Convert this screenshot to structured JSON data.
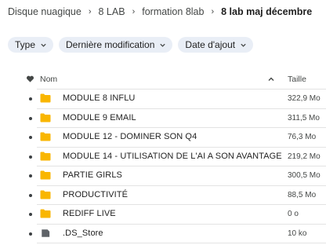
{
  "breadcrumb": {
    "items": [
      "Disque nuagique",
      "8 LAB",
      "formation 8lab"
    ],
    "current": "8 lab maj décembre"
  },
  "filters": [
    {
      "label": "Type"
    },
    {
      "label": "Dernière modification"
    },
    {
      "label": "Date d'ajout"
    }
  ],
  "columns": {
    "name": "Nom",
    "size": "Taille"
  },
  "files": [
    {
      "name": "MODULE 8 INFLU",
      "size": "322,9 Mo",
      "kind": "folder"
    },
    {
      "name": "MODULE 9 EMAIL",
      "size": "311,5 Mo",
      "kind": "folder"
    },
    {
      "name": "MODULE 12 - DOMINER SON Q4",
      "size": "76,3 Mo",
      "kind": "folder"
    },
    {
      "name": "MODULE 14 - UTILISATION DE L'AI A SON AVANTAGE",
      "size": "219,2 Mo",
      "kind": "folder"
    },
    {
      "name": "PARTIE GIRLS",
      "size": "300,5 Mo",
      "kind": "folder"
    },
    {
      "name": "PRODUCTIVITÉ",
      "size": "88,5 Mo",
      "kind": "folder"
    },
    {
      "name": "REDIFF LIVE",
      "size": "0 o",
      "kind": "folder"
    },
    {
      "name": ".DS_Store",
      "size": "10 ko",
      "kind": "file"
    }
  ],
  "colors": {
    "folder": "#f9b600",
    "file": "#5f6368",
    "chip": "#e9eef6"
  }
}
